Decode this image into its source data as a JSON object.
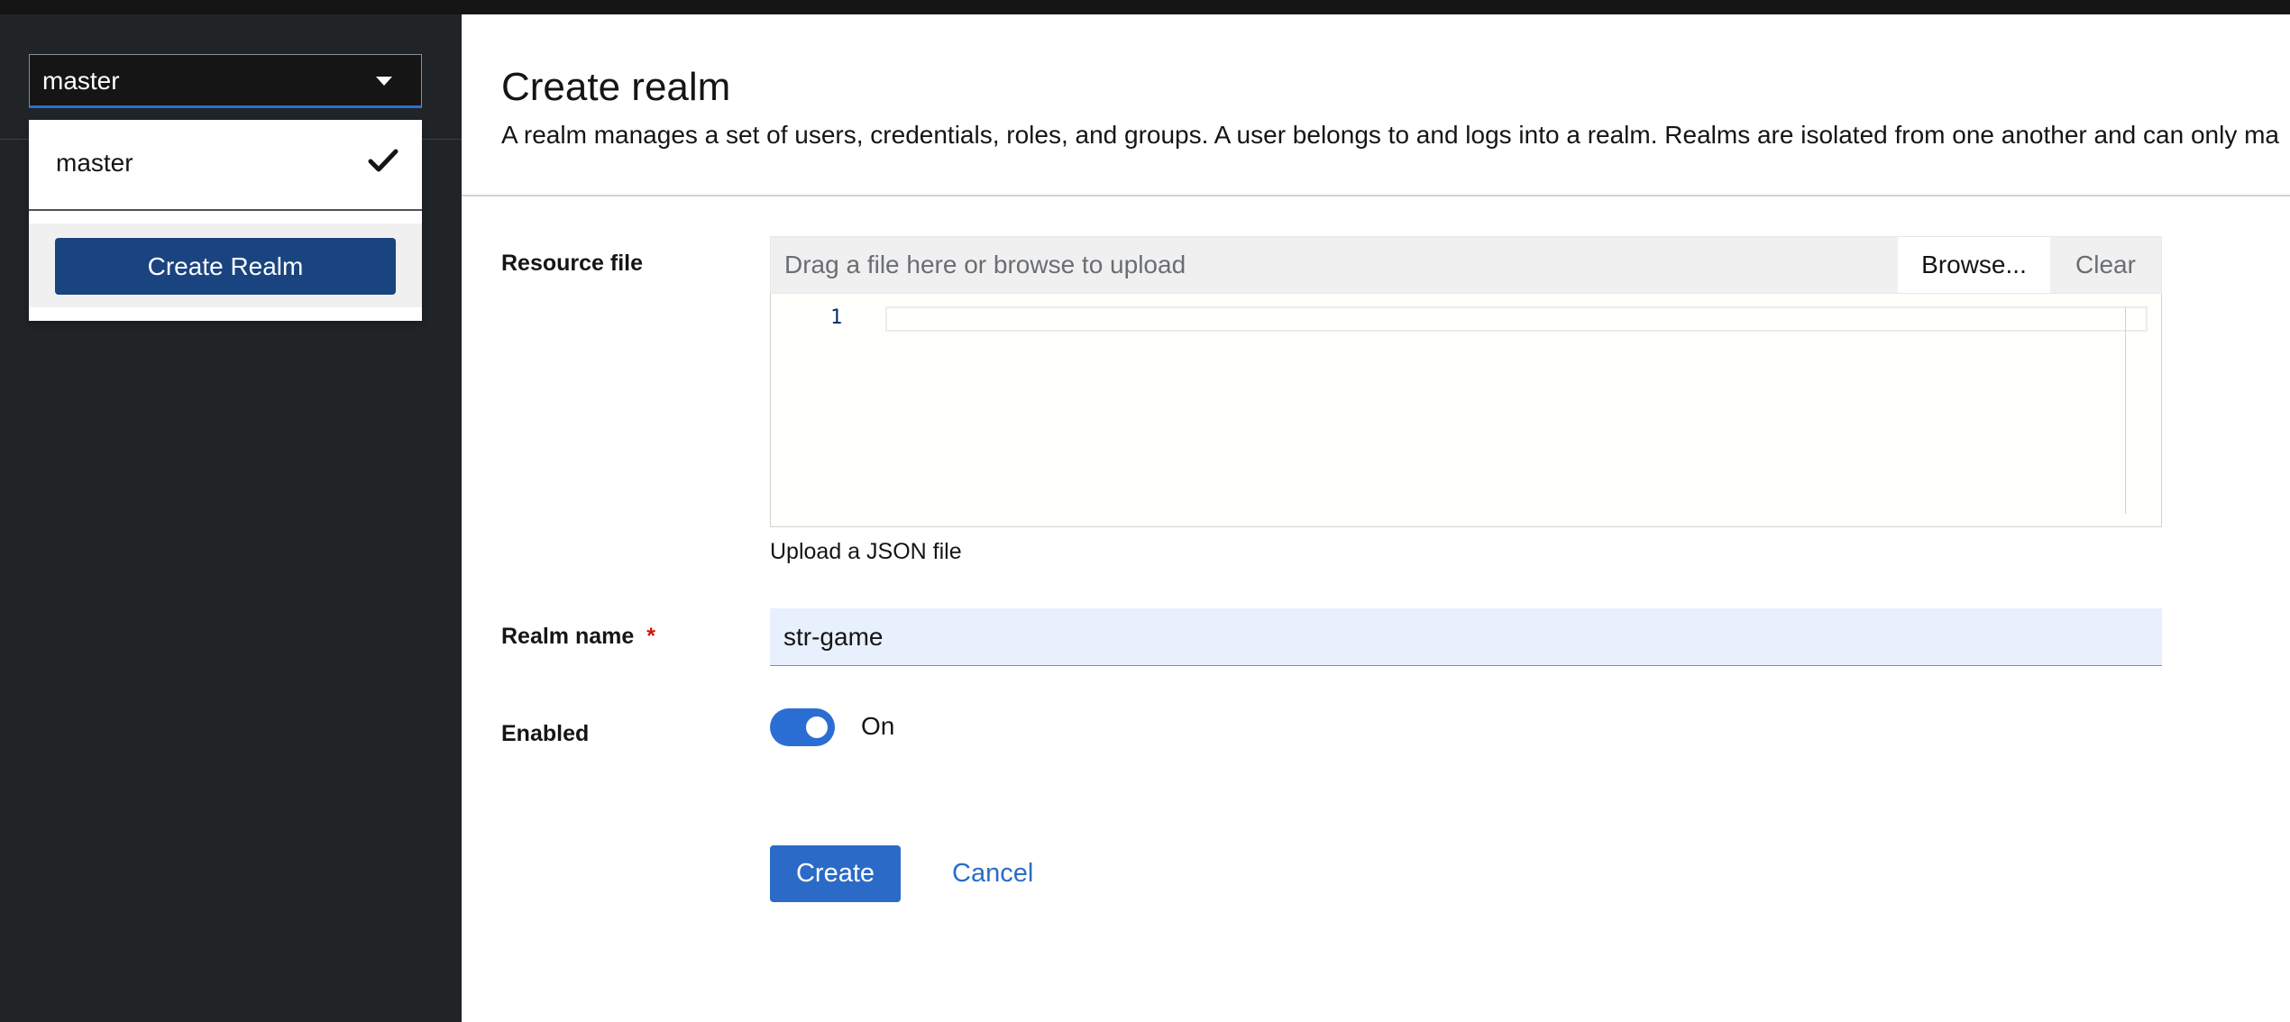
{
  "realm_selector": {
    "selected": "master",
    "menu": {
      "items": [
        {
          "label": "master",
          "selected": true
        }
      ],
      "create_button_label": "Create Realm"
    }
  },
  "page": {
    "title": "Create realm",
    "description": "A realm manages a set of users, credentials, roles, and groups. A user belongs to and logs into a realm. Realms are isolated from one another and can only ma"
  },
  "form": {
    "resource_file": {
      "label": "Resource file",
      "placeholder": "Drag a file here or browse to upload",
      "browse_label": "Browse...",
      "clear_label": "Clear",
      "editor_line_numbers": [
        "1"
      ],
      "editor_content": "",
      "helper_text": "Upload a JSON file"
    },
    "realm_name": {
      "label": "Realm name",
      "required_mark": "*",
      "value": "str-game"
    },
    "enabled": {
      "label": "Enabled",
      "state_label": "On",
      "checked": true
    },
    "actions": {
      "create_label": "Create",
      "cancel_label": "Cancel"
    }
  },
  "colors": {
    "primary": "#2b6bc7",
    "create_realm_button": "#1a4480",
    "sidebar_bg": "#212427",
    "required": "#c9190b",
    "input_autofill_bg": "#e8f0fe"
  }
}
